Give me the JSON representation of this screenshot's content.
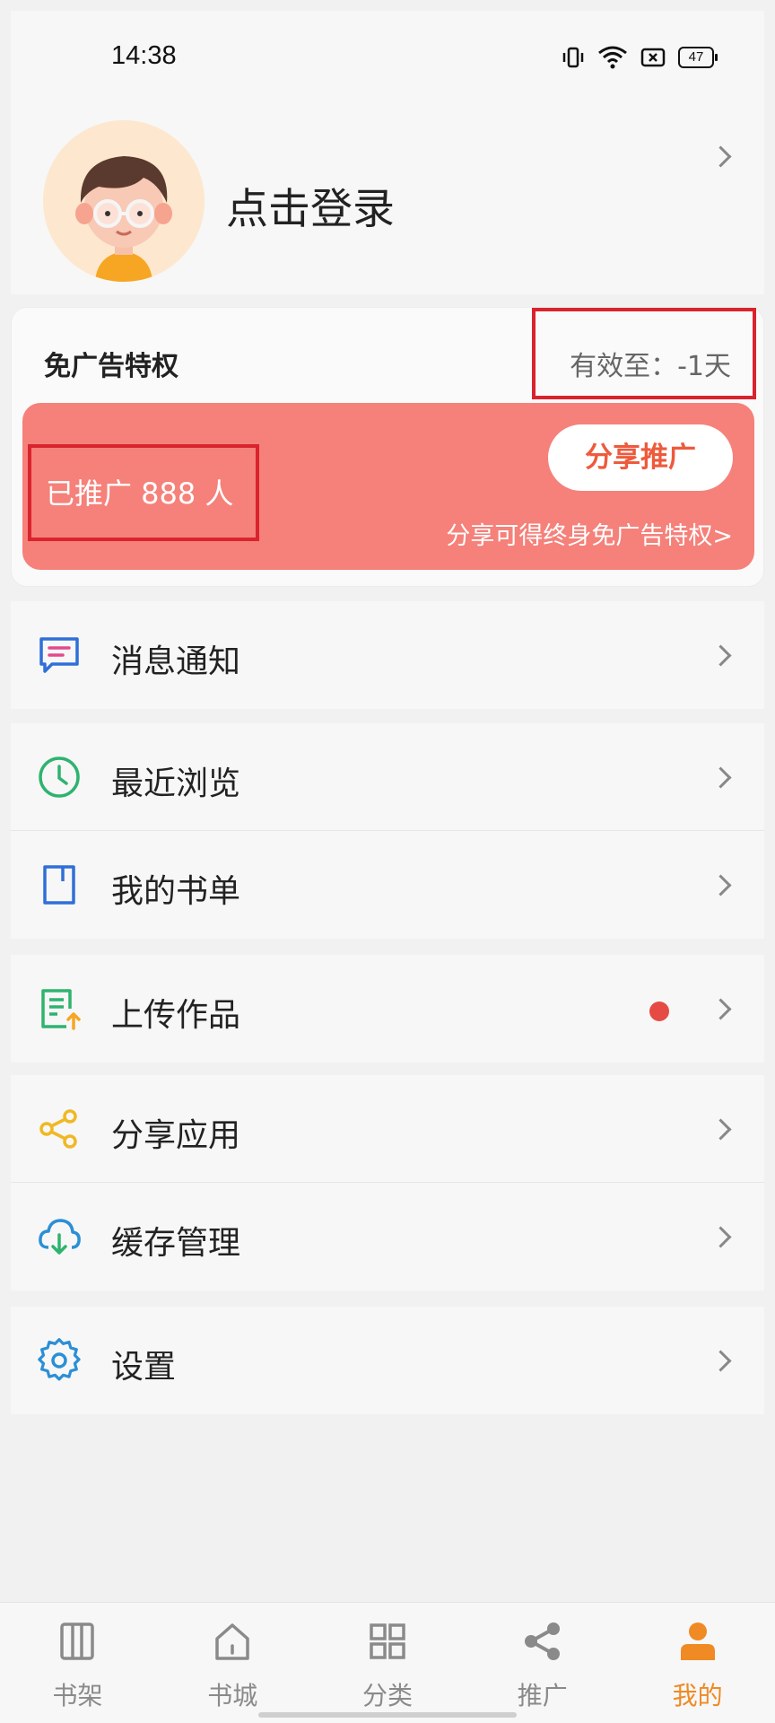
{
  "status_bar": {
    "time": "14:38",
    "battery": "47"
  },
  "profile": {
    "login_text": "点击登录"
  },
  "privilege": {
    "title": "免广告特权",
    "expire_text": "有效至：-1天",
    "promoted_text": "已推广 888 人",
    "share_button": "分享推广",
    "hint": "分享可得终身免广告特权>"
  },
  "menu": {
    "messages": "消息通知",
    "recent": "最近浏览",
    "booklist": "我的书单",
    "upload": "上传作品",
    "share_app": "分享应用",
    "cache": "缓存管理",
    "settings": "设置"
  },
  "nav": {
    "bookshelf": "书架",
    "bookstore": "书城",
    "category": "分类",
    "promote": "推广",
    "mine": "我的"
  },
  "colors": {
    "accent": "#f08a24",
    "promo_bg": "#f5817a",
    "share_text": "#ee5a3c",
    "highlight_box": "#d9232d"
  }
}
